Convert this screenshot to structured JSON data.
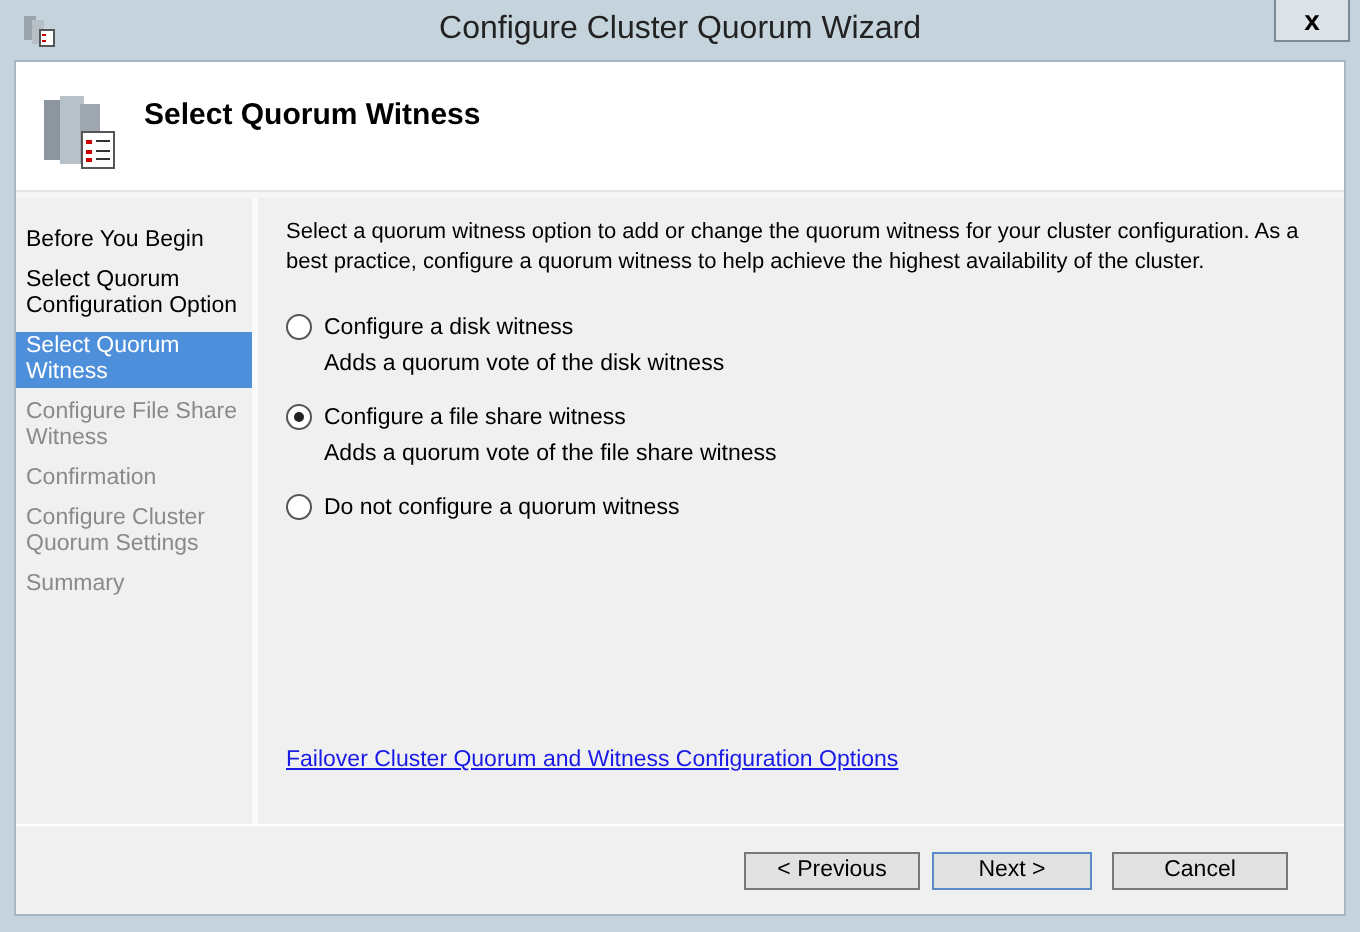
{
  "window": {
    "title": "Configure Cluster Quorum Wizard",
    "close": "x"
  },
  "header": {
    "title": "Select Quorum Witness"
  },
  "steps": [
    {
      "label": "Before You Begin",
      "selected": false,
      "disabled": false
    },
    {
      "label": "Select Quorum Configuration Option",
      "selected": false,
      "disabled": false
    },
    {
      "label": "Select Quorum Witness",
      "selected": true,
      "disabled": false
    },
    {
      "label": "Configure File Share Witness",
      "selected": false,
      "disabled": true
    },
    {
      "label": "Confirmation",
      "selected": false,
      "disabled": true
    },
    {
      "label": "Configure Cluster Quorum Settings",
      "selected": false,
      "disabled": true
    },
    {
      "label": "Summary",
      "selected": false,
      "disabled": true
    }
  ],
  "intro": "Select a quorum witness option to add or change the quorum witness for your cluster configuration. As a best practice, configure a quorum witness to help achieve the highest availability of the cluster.",
  "options": [
    {
      "label": "Configure a disk witness",
      "description": "Adds a quorum vote of the disk witness",
      "selected": false
    },
    {
      "label": "Configure a file share witness",
      "description": "Adds a quorum vote of the file share witness",
      "selected": true
    },
    {
      "label": "Do not configure a quorum witness",
      "selected": false
    }
  ],
  "help_link": "Failover Cluster Quorum and Witness Configuration Options",
  "buttons": [
    {
      "label": "< Previous",
      "default": false
    },
    {
      "label": "Next >",
      "default": true
    },
    {
      "label": "Cancel",
      "default": false
    }
  ]
}
